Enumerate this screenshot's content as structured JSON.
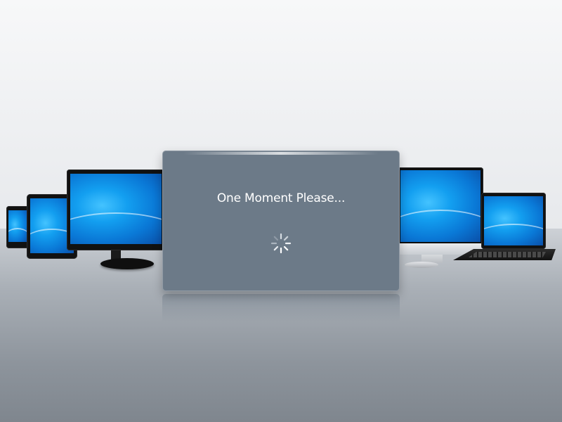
{
  "dialog": {
    "title": "One Moment Please..."
  },
  "spinner": {
    "icon": "loading-spinner-icon"
  },
  "devices": [
    "small-tablet",
    "tablet",
    "monitor",
    "all-in-one",
    "laptop"
  ],
  "colors": {
    "dialog_bg": "#6c7a88",
    "title_text": "#ffffff",
    "screen_blue": "#139ff0"
  }
}
